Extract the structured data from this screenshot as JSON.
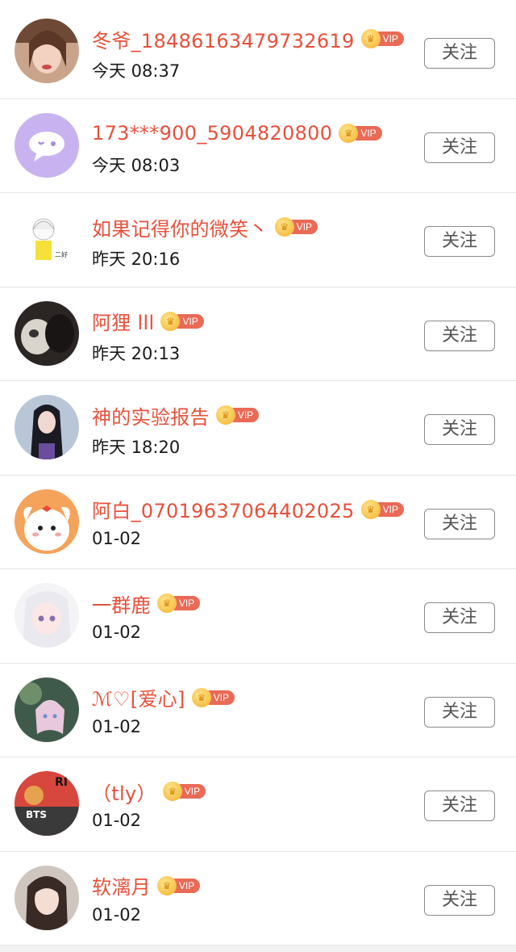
{
  "follow_label": "关注",
  "vip_label": "VIP",
  "users": [
    {
      "name": "冬爷_18486163479732619",
      "time": "今天 08:37",
      "avatar": "woman-portrait"
    },
    {
      "name": "173***900_5904820800",
      "time": "今天 08:03",
      "avatar": "purple-chat-bubble"
    },
    {
      "name": "如果记得你的微笑丶",
      "time": "昨天 20:16",
      "avatar": "cartoon-girl-yellow"
    },
    {
      "name": "阿狸 lll",
      "time": "昨天 20:13",
      "avatar": "cat-photo"
    },
    {
      "name": "神的实验报告",
      "time": "昨天 18:20",
      "avatar": "performer-photo"
    },
    {
      "name": "阿白_07019637064402025",
      "time": "01-02",
      "avatar": "orange-cartoon-dog"
    },
    {
      "name": "一群鹿",
      "time": "01-02",
      "avatar": "anime-girl-white-hair"
    },
    {
      "name": "ℳ♡[爱心]",
      "time": "01-02",
      "avatar": "anime-girl-scene"
    },
    {
      "name": "（tly）",
      "time": "01-02",
      "avatar": "bts-poster"
    },
    {
      "name": "软漓月",
      "time": "01-02",
      "avatar": "girl-portrait"
    }
  ],
  "colors": {
    "name": "#e8503a",
    "vip_tag": "#e96a56",
    "crown": "#f2b12c"
  }
}
